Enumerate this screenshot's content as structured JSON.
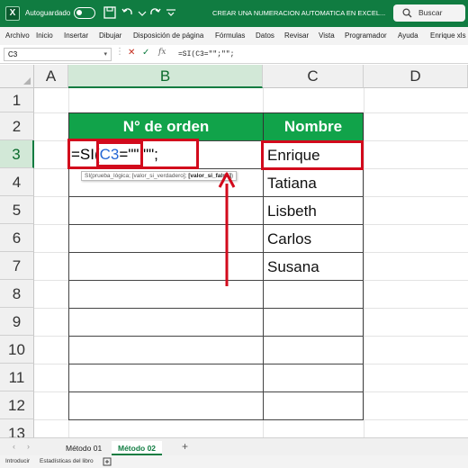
{
  "titlebar": {
    "autosave_label": "Autoguardado",
    "doc_title": "CREAR UNA NUMERACION AUTOMATICA EN EXCEL...",
    "search_label": "Buscar",
    "bg_color": "#107c41"
  },
  "menu": [
    "Archivo",
    "Inicio",
    "Insertar",
    "Dibujar",
    "Disposición de página",
    "Fórmulas",
    "Datos",
    "Revisar",
    "Vista",
    "Programador",
    "Ayuda",
    "Enrique xls"
  ],
  "formula_bar": {
    "name_box": "C3",
    "fx_label": "fx",
    "formula": "=SI(C3=\"\";\"\";"
  },
  "columns": [
    "A",
    "B",
    "C",
    "D"
  ],
  "rows": [
    "1",
    "2",
    "3",
    "4",
    "5",
    "6",
    "7",
    "8",
    "9",
    "10",
    "11",
    "12",
    "13"
  ],
  "table": {
    "header_order": "N° de orden",
    "header_name": "Nombre",
    "names": [
      "Enrique",
      "Tatiana",
      "Lisbeth",
      "Carlos",
      "Susana"
    ],
    "header_color": "#11a34a"
  },
  "editing": {
    "prefix": "=SI(",
    "ref": "C3",
    "suffix": "=\"\";\"\";",
    "tooltip_args": "SI(prueba_lógica; [valor_si_verdadero]; ",
    "tooltip_bold": "[valor_si_falso]",
    "tooltip_end": ")"
  },
  "annotation_color": "#d20a1c",
  "sheets": [
    "Método 01",
    "Método 02"
  ],
  "active_sheet": "Método 02",
  "status": {
    "mode": "Introducir",
    "stats": "Estadísticas del libro"
  }
}
